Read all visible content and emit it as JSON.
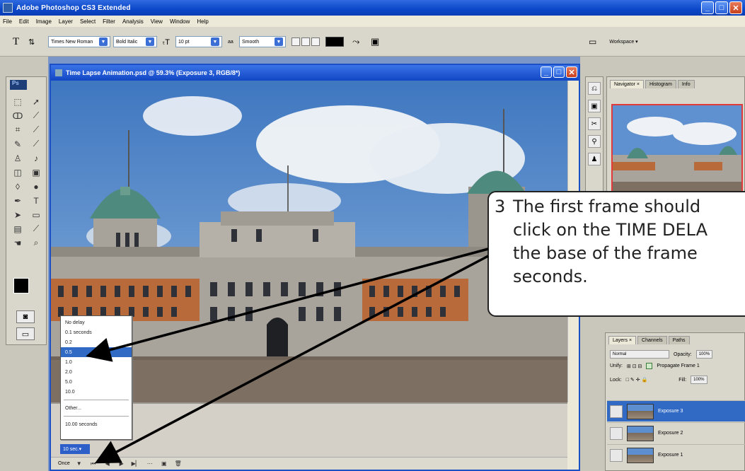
{
  "app": {
    "title": "Adobe Photoshop CS3 Extended",
    "window_buttons": [
      "_",
      "□",
      "✕"
    ]
  },
  "menu": [
    "File",
    "Edit",
    "Image",
    "Layer",
    "Select",
    "Filter",
    "Analysis",
    "View",
    "Window",
    "Help"
  ],
  "options_bar": {
    "tool_glyph": "T",
    "font_family": "Times New Roman",
    "font_style": "Bold Italic",
    "font_size": "10 pt",
    "antialias": "Smooth",
    "antialias_prefix": "aa",
    "workspace_label": "Workspace ▾"
  },
  "document": {
    "title": "Time Lapse Animation.psd @ 59.3% (Exposure 3, RGB/8*)"
  },
  "delay_menu": {
    "items": [
      "No delay",
      "0.1 seconds",
      "0.2",
      "0.5",
      "1.0",
      "2.0",
      "5.0",
      "10.0"
    ],
    "selected": "0.5",
    "other": "Other...",
    "current": "10.00 seconds"
  },
  "animation": {
    "frame_delay": "10 sec.▾",
    "loop": "Once"
  },
  "panels": {
    "navigator_tabs": [
      "Navigator ×",
      "Histogram",
      "Info"
    ],
    "layers_tabs": [
      "Layers ×",
      "Channels",
      "Paths"
    ],
    "blend_mode": "Normal",
    "opacity_label": "Opacity:",
    "opacity_value": "100%",
    "unify_label": "Unify:",
    "propagate_label": "Propagate Frame 1",
    "lock_label": "Lock:",
    "fill_label": "Fill:",
    "fill_value": "100%",
    "layers": [
      "Exposure 3",
      "Exposure 2",
      "Exposure 1"
    ],
    "active_layer": "Exposure 3"
  },
  "callout": {
    "number": "3",
    "lines": [
      "The first frame should",
      "click on the TIME DELA",
      "the base of the frame",
      "seconds."
    ]
  },
  "colors": {
    "selection_blue": "#316ac5",
    "title_blue": "#0b47c8",
    "thumb_border": "#e23a3a"
  }
}
